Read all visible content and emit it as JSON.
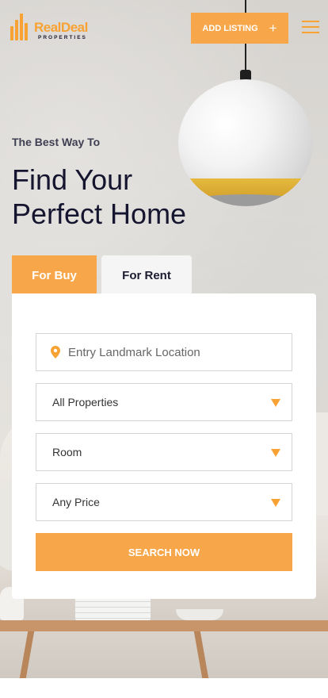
{
  "header": {
    "logo": {
      "word1": "Real",
      "word2": "Deal",
      "sub": "PROPERTIES"
    },
    "add_listing_label": "ADD LISTING",
    "add_icon": "plus-icon",
    "menu_icon": "hamburger-menu-icon"
  },
  "hero": {
    "tagline": "The Best Way To",
    "headline_line1": "Find Your",
    "headline_line2": "Perfect Home"
  },
  "tabs": [
    {
      "label": "For Buy",
      "active": true
    },
    {
      "label": "For Rent",
      "active": false
    }
  ],
  "search_form": {
    "location_placeholder": "Entry Landmark Location",
    "location_icon": "map-pin-icon",
    "selects": [
      {
        "value": "All Properties"
      },
      {
        "value": "Room"
      },
      {
        "value": "Any Price"
      }
    ],
    "submit_label": "SEARCH NOW"
  },
  "colors": {
    "accent": "#f7a74a",
    "text_dark": "#151530"
  }
}
